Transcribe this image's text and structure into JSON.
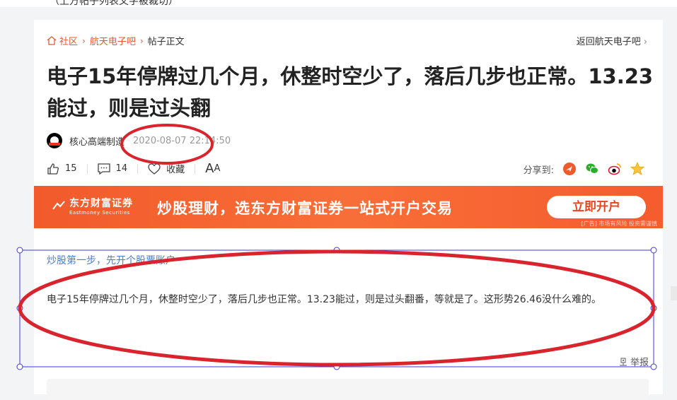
{
  "top_strip_text": "（上方帖子列表文字被裁切）",
  "breadcrumb": {
    "community": "社区",
    "forum": "航天电子吧",
    "current": "帖子正文"
  },
  "back_link": "返回航天电子吧",
  "post": {
    "title": "电子15年停牌过几个月，休整时空少了，落后几步也正常。13.23能过，则是过头翻",
    "author": "核心高端制造",
    "timestamp": "2020-08-07 22:14:50",
    "likes": "15",
    "comments": "14",
    "favorite_label": "收藏",
    "font_size_label_big": "A",
    "font_size_label_small": "A",
    "share_label": "分享到:",
    "promo_link": "炒股第一步，先开个股票账户",
    "body": "电子15年停牌过几个月，休整时空少了，落后几步也正常。13.23能过，则是过头翻番，等就是了。这形势26.46没什么难的。",
    "report_label": "举报"
  },
  "banner": {
    "brand_cn": "东方财富证券",
    "brand_en": "Eastmoney Securities",
    "slogan": "炒股理财，选东方财富证券一站式开户交易",
    "cta": "立即开户",
    "note": "[广告] 市场有风险 投资需谨慎"
  },
  "share_targets": [
    "weibo-alt-icon",
    "wechat-icon",
    "weibo-icon",
    "qzone-icon"
  ],
  "colors": {
    "accent": "#e15b2f",
    "banner": "#f25a2b",
    "link": "#4a7fd0",
    "annotation": "#d9232d",
    "selection": "#3b3bd6"
  }
}
